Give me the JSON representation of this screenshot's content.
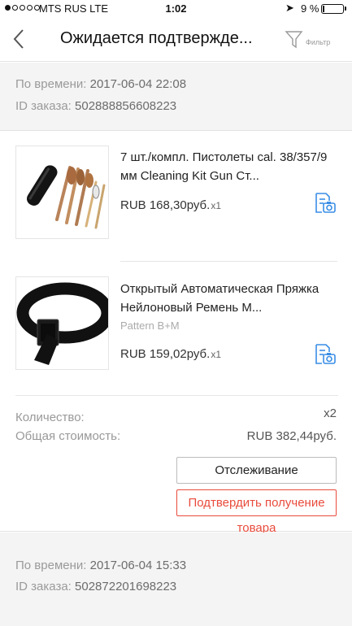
{
  "status_bar": {
    "carrier": "MTS RUS  LTE",
    "time": "1:02",
    "battery": "9 %",
    "battery_level": 0.09
  },
  "header": {
    "title": "Ожидается подтвержде...",
    "filter_label": "Фильтр"
  },
  "orders": [
    {
      "time_label": "По времени: ",
      "time_value": "2017-06-04 22:08",
      "id_label": "ID заказа: ",
      "id_value": "502888856608223",
      "items": [
        {
          "title": "7 шт./компл. Пистолеты cal. 38/357/9 мм Cleaning Kit Gun Ст...",
          "variant": "",
          "price": "RUB 168,30руб.",
          "qty": "x1"
        },
        {
          "title": "Открытый Автоматическая Пряжка Нейлоновый Ремень М...",
          "variant": "Pattern B+M",
          "price": "RUB 159,02руб.",
          "qty": "x1"
        }
      ],
      "quantity_label": "Количество:",
      "quantity_value": "x2",
      "total_label": "Общая стоимость:",
      "total_value": "RUB 382,44руб.",
      "track_button": "Отслеживание",
      "confirm_button": "Подтвердить получение товара"
    },
    {
      "time_label": "По времени: ",
      "time_value": "2017-06-04 15:33",
      "id_label": "ID заказа: ",
      "id_value": "502872201698223"
    }
  ],
  "colors": {
    "accent_red": "#e94b3c",
    "icon_blue": "#3a8ee6",
    "section_bg": "#f4f4f4"
  },
  "icons": [
    "back-chevron-icon",
    "filter-funnel-icon",
    "photo-review-icon"
  ]
}
